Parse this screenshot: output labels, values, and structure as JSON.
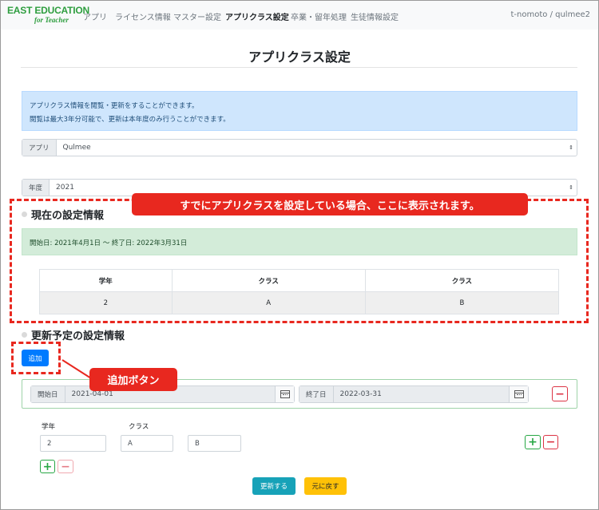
{
  "brand": {
    "main": "EAST EDUCATION",
    "sub": "for Teacher",
    "color": "#2e9e3f"
  },
  "nav": {
    "items": [
      "アプリ",
      "ライセンス情報",
      "マスター設定",
      "アプリクラス設定",
      "卒業・留年処理",
      "生徒情報設定"
    ],
    "active_index": 3,
    "user": "t-nomoto / qulmee2"
  },
  "page": {
    "title": "アプリクラス設定",
    "info_lines": [
      "アプリクラス情報を閲覧・更新をすることができます。",
      "閲覧は最大3年分可能で、更新は本年度のみ行うことができます。"
    ]
  },
  "app_select": {
    "label": "アプリ",
    "value": "Qulmee",
    "caret": "⇕"
  },
  "year_select": {
    "label": "年度",
    "value": "2021",
    "caret": "⇕"
  },
  "current": {
    "heading": "現在の設定情報",
    "period": "開始日: 2021年4月1日 〜 終了日: 2022年3月31日",
    "headers": [
      "学年",
      "クラス",
      "クラス"
    ],
    "row": [
      "2",
      "A",
      "B"
    ]
  },
  "update": {
    "heading": "更新予定の設定情報",
    "add_label": "追加",
    "start_label": "開始日",
    "start_value": "2021-04-01",
    "end_label": "終了日",
    "end_value": "2022-03-31",
    "grade_label": "学年",
    "class_label": "クラス",
    "grade_value": "2",
    "class_values": [
      "A",
      "B"
    ],
    "plus": "+",
    "minus": "−",
    "submit_label": "更新する",
    "back_label": "元に戻す"
  },
  "annotations": {
    "callout_top": "すでにアプリクラスを設定している場合、ここに表示されます。",
    "callout_add": "追加ボタン",
    "color": "#e8281f"
  }
}
